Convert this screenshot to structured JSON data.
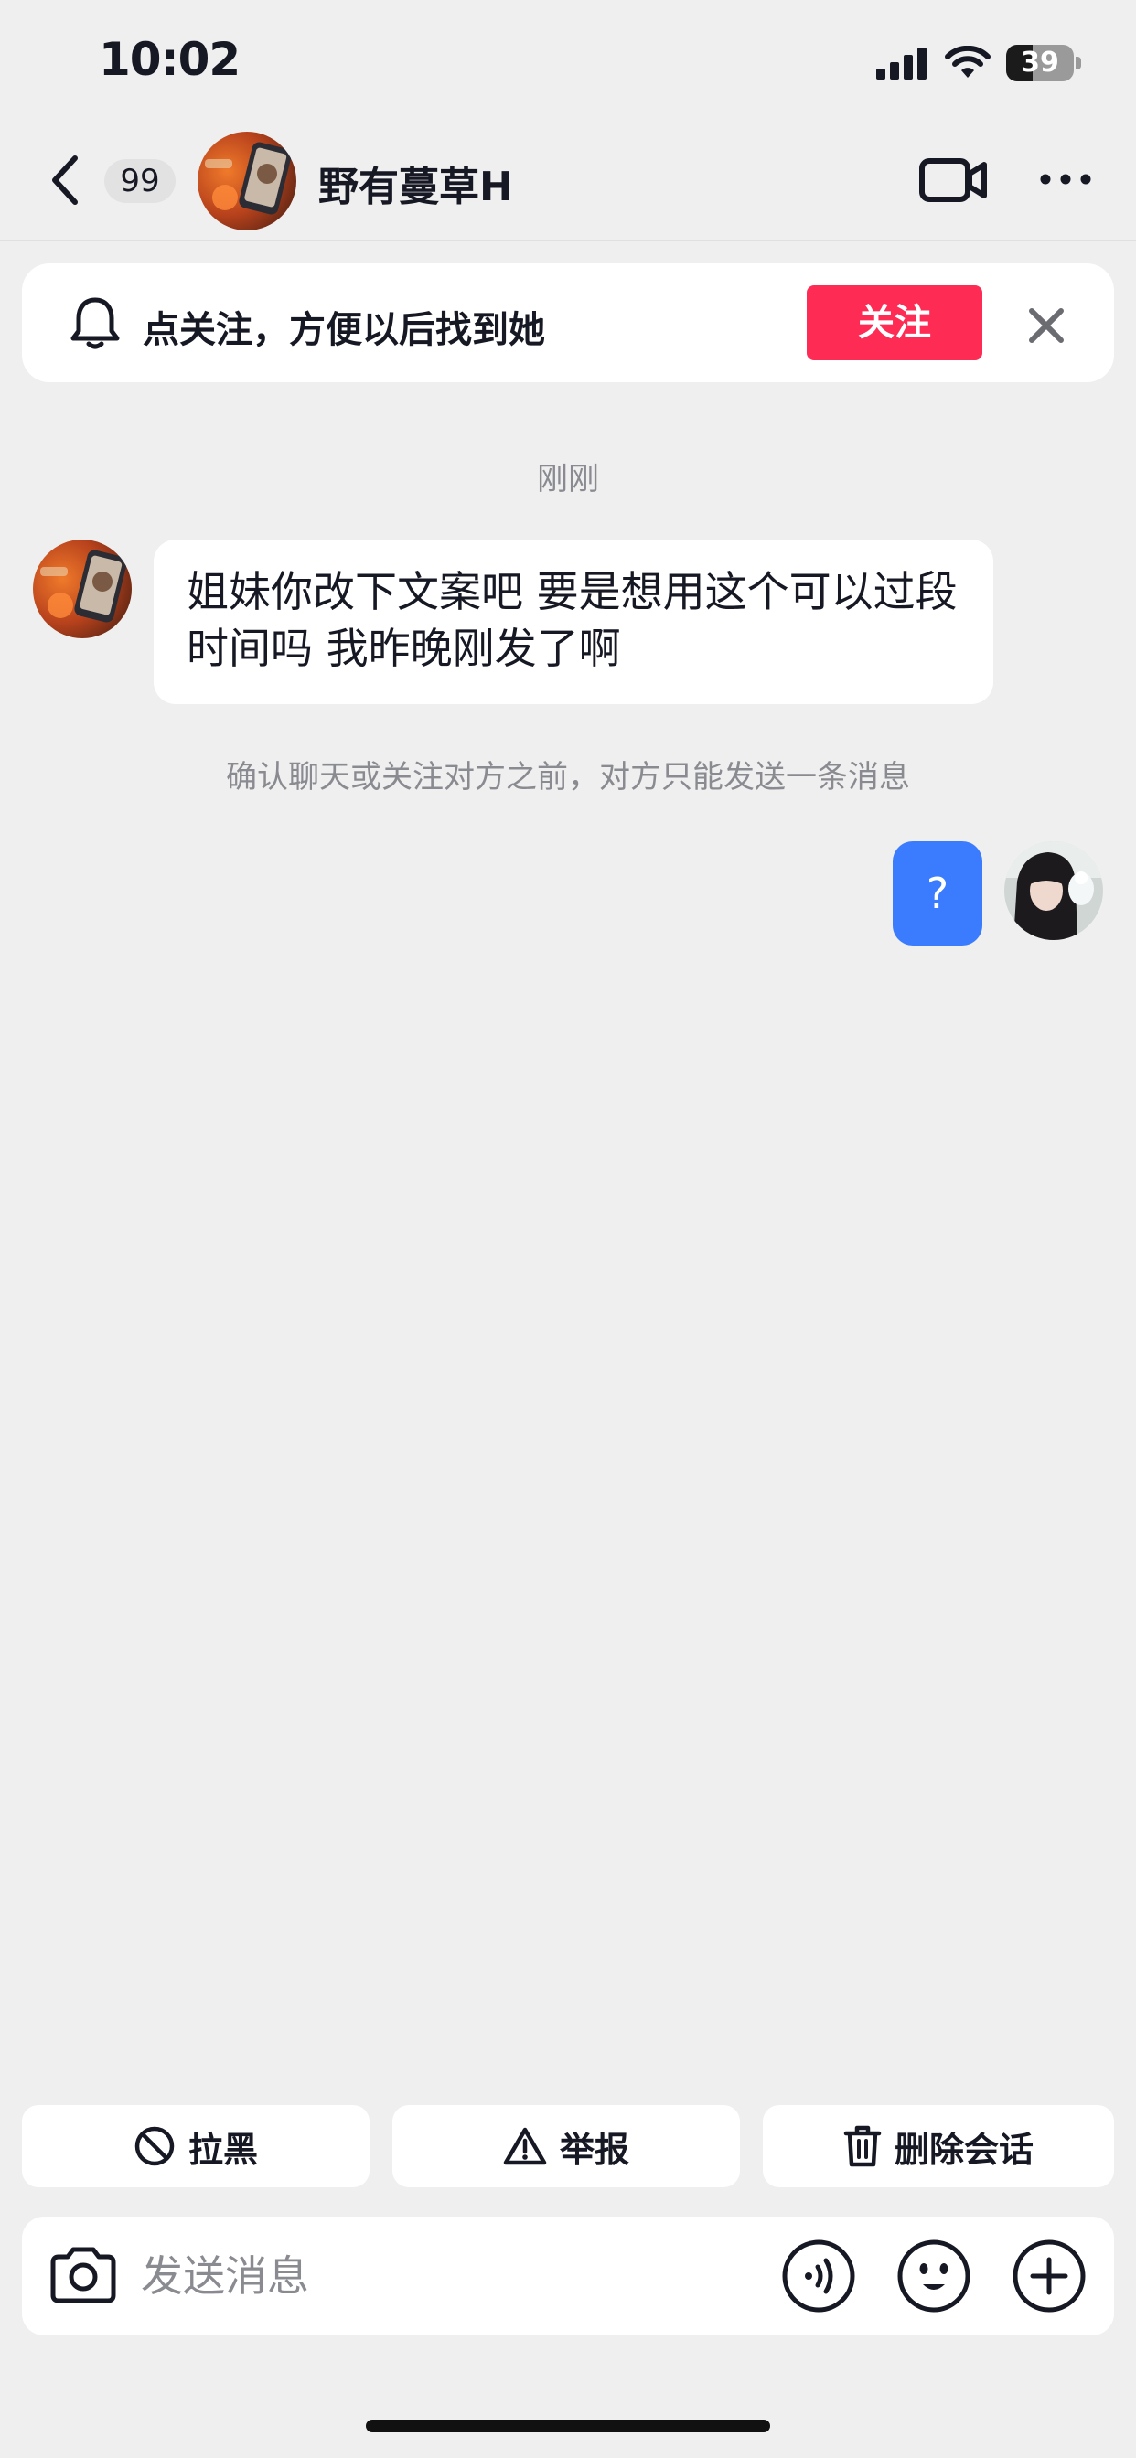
{
  "status_bar": {
    "time": "10:02",
    "battery_level": "39",
    "battery_fraction": 0.39,
    "icons": [
      "cellular-signal-icon",
      "wifi-icon",
      "battery-icon"
    ]
  },
  "nav": {
    "unread_count": "99",
    "contact_name": "野有蔓草H",
    "icons": [
      "chevron-left-icon",
      "video-camera-icon",
      "more-dots-icon"
    ]
  },
  "follow_banner": {
    "text": "点关注，方便以后找到她",
    "button_label": "关注",
    "icons": [
      "bell-icon",
      "close-icon"
    ]
  },
  "chat": {
    "timestamp": "刚刚",
    "messages": [
      {
        "side": "left",
        "text": "姐妹你改下文案吧 要是想用这个可以过段时间吗 我昨晚刚发了啊"
      },
      {
        "side": "right",
        "text": "?"
      }
    ],
    "notice": "确认聊天或关注对方之前，对方只能发送一条消息"
  },
  "actions": {
    "block_label": "拉黑",
    "report_label": "举报",
    "delete_label": "删除会话",
    "icons": [
      "block-icon",
      "warning-icon",
      "trash-icon"
    ]
  },
  "composer": {
    "placeholder": "发送消息",
    "value": "",
    "icons": [
      "camera-icon",
      "voice-icon",
      "emoji-icon",
      "plus-icon"
    ]
  },
  "colors": {
    "accent": "#fe2c55",
    "bubble_self": "#3b7cff",
    "background": "#efefef",
    "surface": "#ffffff",
    "muted_text": "#8a8b91",
    "primary_text": "#161823"
  }
}
